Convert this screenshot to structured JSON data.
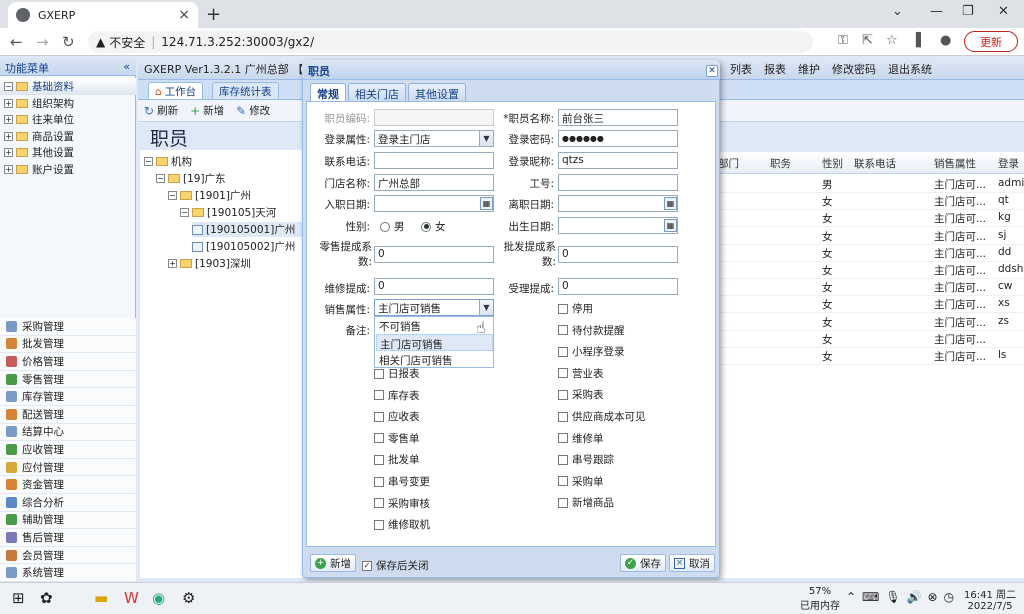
{
  "browser": {
    "tab_title": "GXERP",
    "url": "124.71.3.252:30003/gx2/",
    "security": "不安全",
    "update": "更新"
  },
  "app": {
    "title": "GXERP Ver1.3.2.1 广州总部 【广",
    "menu": [
      "列表",
      "报表",
      "维护",
      "修改密码",
      "退出系统"
    ]
  },
  "sidebar": {
    "header": "功能菜单",
    "tree": [
      {
        "label": "基础资料",
        "head": true
      },
      {
        "label": "组织架构"
      },
      {
        "label": "往来单位"
      },
      {
        "label": "商品设置"
      },
      {
        "label": "其他设置"
      },
      {
        "label": "账户设置"
      }
    ],
    "modules": [
      "采购管理",
      "批发管理",
      "价格管理",
      "零售管理",
      "库存管理",
      "配送管理",
      "结算中心",
      "应收管理",
      "应付管理",
      "资金管理",
      "综合分析",
      "辅助管理",
      "售后管理",
      "会员管理",
      "系统管理"
    ]
  },
  "main": {
    "tabs": [
      "工作台",
      "库存统计表"
    ],
    "toolbar": [
      "刷新",
      "新增",
      "修改"
    ],
    "page_title": "职员",
    "tree": [
      {
        "label": "机构",
        "lvl": 0
      },
      {
        "label": "[19]广东",
        "lvl": 1
      },
      {
        "label": "[1901]广州",
        "lvl": 2
      },
      {
        "label": "[190105]天河",
        "lvl": 3
      },
      {
        "label": "[190105001]广州",
        "lvl": 4,
        "sel": true
      },
      {
        "label": "[190105002]广州",
        "lvl": 4
      },
      {
        "label": "[1903]深圳",
        "lvl": 2
      }
    ],
    "grid": {
      "headers": [
        "部门",
        "职务",
        "性别",
        "联系电话",
        "销售属性",
        "登录"
      ],
      "rows": [
        [
          "男",
          "主门店可...",
          "admi"
        ],
        [
          "女",
          "主门店可...",
          "qt"
        ],
        [
          "女",
          "主门店可...",
          "kg"
        ],
        [
          "女",
          "主门店可...",
          "sj"
        ],
        [
          "女",
          "主门店可...",
          "dd"
        ],
        [
          "女",
          "主门店可...",
          "ddsh"
        ],
        [
          "女",
          "主门店可...",
          "cw"
        ],
        [
          "女",
          "主门店可...",
          "xs"
        ],
        [
          "女",
          "主门店可...",
          "zs"
        ],
        [
          "女",
          "主门店可...",
          ""
        ],
        [
          "女",
          "主门店可...",
          "ls"
        ]
      ]
    }
  },
  "taskbar": {
    "mem": "57%",
    "mem_label": "已用内存",
    "time": "16:41 周二",
    "date": "2022/7/5"
  },
  "dialog": {
    "title": "职员",
    "tabs": [
      "常规",
      "相关门店",
      "其他设置"
    ],
    "labels": {
      "code": "职员编码:",
      "name": "*职员名称:",
      "login_attr": "登录属性:",
      "password": "登录密码:",
      "phone": "联系电话:",
      "nickname": "登录昵称:",
      "store": "门店名称:",
      "workno": "工号:",
      "join": "入职日期:",
      "leave": "离职日期:",
      "gender": "性别:",
      "birth": "出生日期:",
      "retail": "零售提成系数:",
      "wholesale": "批发提成系数:",
      "repair": "维修提成:",
      "accept": "受理提成:",
      "sales_attr": "销售属性:",
      "note": "备注:"
    },
    "values": {
      "code": "",
      "name": "前台张三",
      "login_attr": "登录主门店",
      "password": "●●●●●●",
      "phone": "",
      "nickname": "qtzs",
      "store": "广州总部",
      "workno": "",
      "join": "",
      "leave": "",
      "birth": "",
      "retail": "0",
      "wholesale": "0",
      "repair": "0",
      "accept": "0",
      "sales_attr": "主门店可销售"
    },
    "gender": {
      "male": "男",
      "female": "女"
    },
    "dropdown": [
      "不可销售",
      "主门店可销售",
      "相关门店可销售"
    ],
    "checks_left": [
      "日报表",
      "库存表",
      "应收表",
      "零售单",
      "批发单",
      "串号变更",
      "采购审核",
      "维修取机"
    ],
    "checks_right": [
      "停用",
      "待付款提醒",
      "小程序登录",
      "营业表",
      "采购表",
      "供应商成本可见",
      "维修单",
      "串号跟踪",
      "采购单",
      "新增商品"
    ],
    "footer": {
      "add": "新增",
      "save_close": "保存后关闭",
      "save": "保存",
      "cancel": "取消"
    }
  }
}
